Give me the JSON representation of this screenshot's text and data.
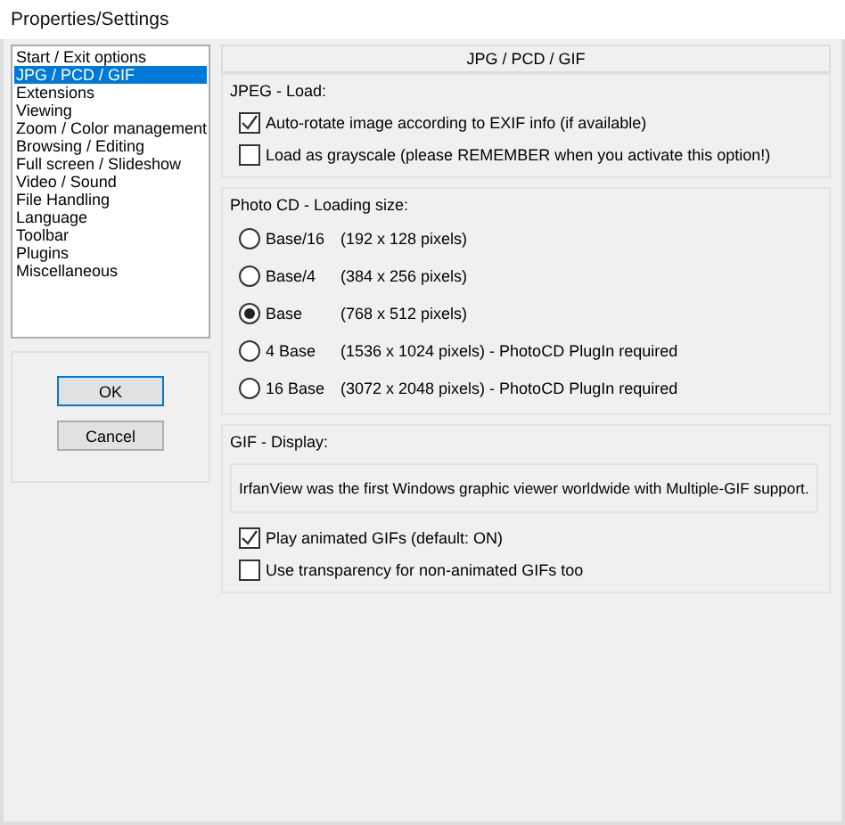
{
  "window": {
    "title": "Properties/Settings"
  },
  "sidebar": {
    "items": [
      {
        "label": "Start / Exit options",
        "selected": false
      },
      {
        "label": "JPG / PCD / GIF",
        "selected": true
      },
      {
        "label": "Extensions",
        "selected": false
      },
      {
        "label": "Viewing",
        "selected": false
      },
      {
        "label": "Zoom / Color management",
        "selected": false
      },
      {
        "label": "Browsing / Editing",
        "selected": false
      },
      {
        "label": "Full screen / Slideshow",
        "selected": false
      },
      {
        "label": "Video / Sound",
        "selected": false
      },
      {
        "label": "File Handling",
        "selected": false
      },
      {
        "label": "Language",
        "selected": false
      },
      {
        "label": "Toolbar",
        "selected": false
      },
      {
        "label": "Plugins",
        "selected": false
      },
      {
        "label": "Miscellaneous",
        "selected": false
      }
    ]
  },
  "buttons": [
    {
      "label": "OK",
      "default": true
    },
    {
      "label": "Cancel",
      "default": false
    }
  ],
  "page_title": "JPG / PCD / GIF",
  "jpeg_group": {
    "title": "JPEG - Load:",
    "options": [
      {
        "label": "Auto-rotate image according to EXIF info (if available)",
        "checked": true
      },
      {
        "label": "Load as grayscale (please REMEMBER when you activate this option!)",
        "checked": false
      }
    ]
  },
  "photocd_group": {
    "title": "Photo CD - Loading size:",
    "options": [
      {
        "label": "Base/16",
        "detail": "(192 x 128 pixels)",
        "selected": false
      },
      {
        "label": "Base/4",
        "detail": "(384 x 256 pixels)",
        "selected": false
      },
      {
        "label": "Base",
        "detail": "(768 x 512 pixels)",
        "selected": true
      },
      {
        "label": "4 Base",
        "detail": "(1536 x 1024 pixels) - PhotoCD PlugIn required",
        "selected": false
      },
      {
        "label": "16 Base",
        "detail": "(3072 x 2048 pixels) - PhotoCD PlugIn required",
        "selected": false
      }
    ]
  },
  "gif_group": {
    "title": "GIF - Display:",
    "info": "IrfanView was the first Windows graphic viewer worldwide with Multiple-GIF support.",
    "options": [
      {
        "label": "Play animated GIFs (default: ON)",
        "checked": true
      },
      {
        "label": "Use transparency for non-animated GIFs too",
        "checked": false
      }
    ]
  }
}
